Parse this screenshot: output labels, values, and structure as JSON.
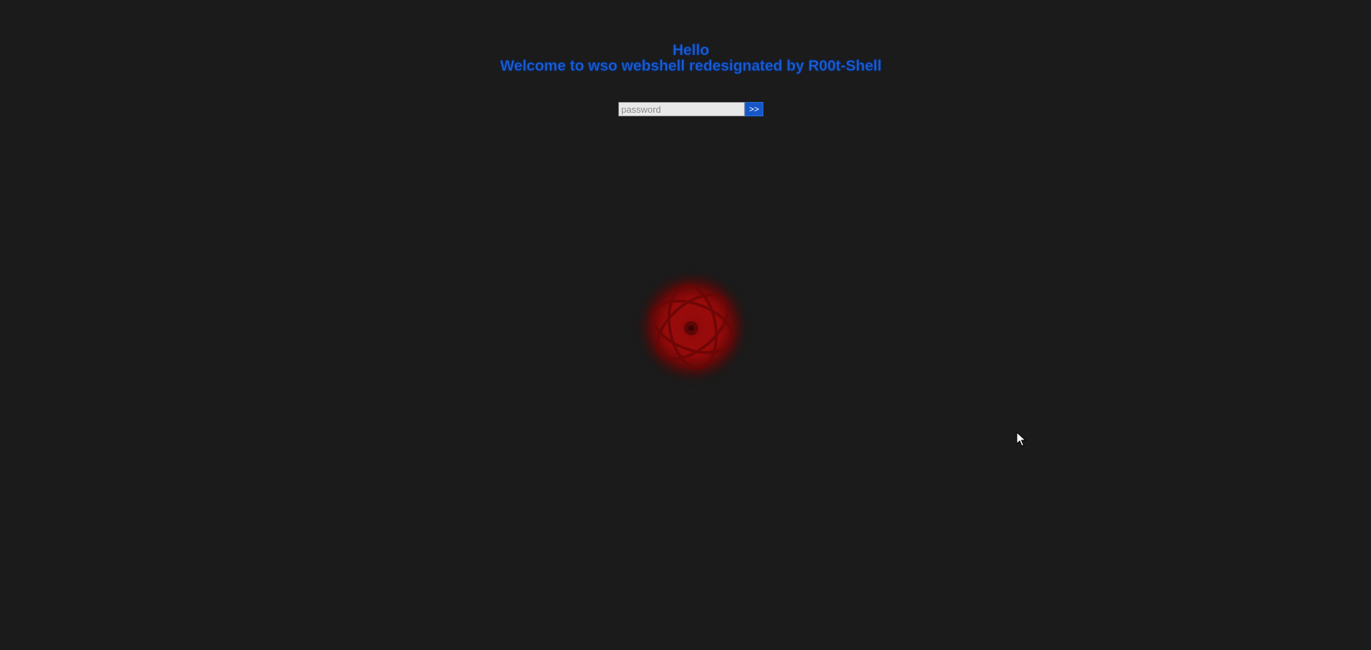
{
  "greeting": {
    "line1": "Hello",
    "line2": "Welcome to wso webshell redesignated by R00t-Shell"
  },
  "login": {
    "password_placeholder": "password",
    "password_value": "",
    "submit_label": ">>"
  },
  "colors": {
    "background": "#1b1b1b",
    "heading": "#1b5fd6",
    "button": "#1656c7",
    "emblem": "#9d0b0b"
  },
  "icons": {
    "emblem": "red-atom-orbit-icon",
    "cursor": "mouse-pointer-icon"
  }
}
